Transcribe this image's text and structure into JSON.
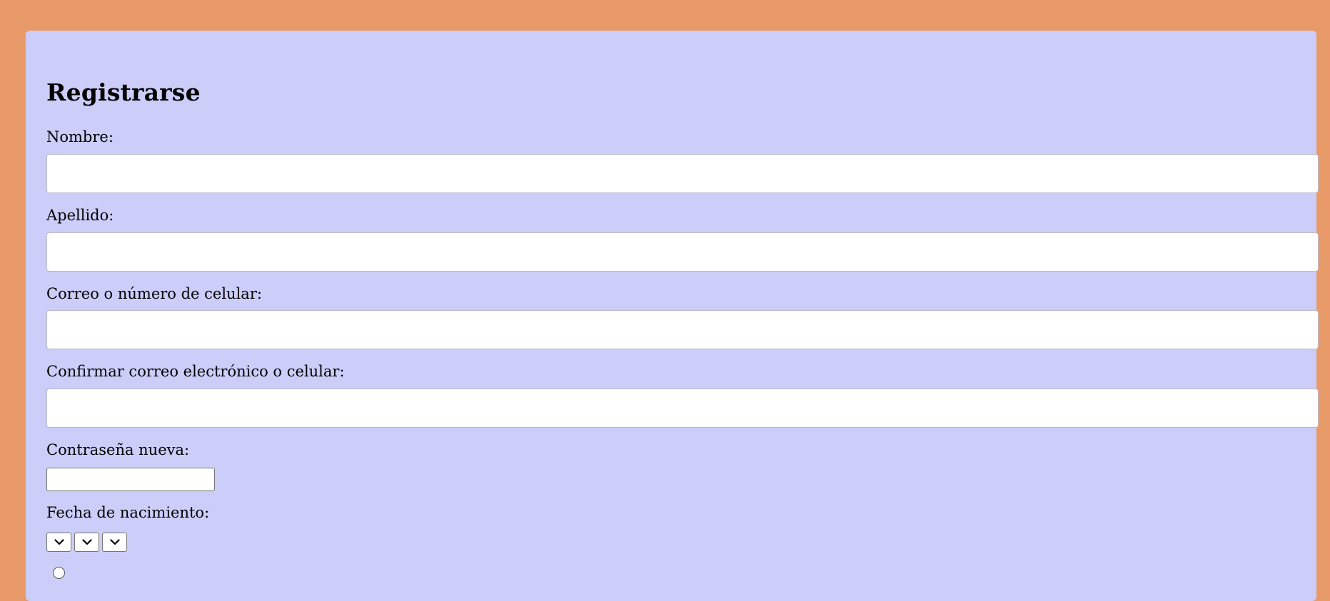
{
  "form": {
    "title": "Registrarse",
    "fields": [
      {
        "label": "Nombre:",
        "value": "",
        "placeholder": ""
      },
      {
        "label": "Apellido:",
        "value": "",
        "placeholder": ""
      },
      {
        "label": "Correo o número de celular:",
        "value": "",
        "placeholder": ""
      },
      {
        "label": "Confirmar correo electrónico o celular:",
        "value": "",
        "placeholder": ""
      }
    ],
    "password": {
      "label": "Contraseña nueva:",
      "value": ""
    },
    "birthdate": {
      "label": "Fecha de nacimiento:",
      "day": "",
      "month": "",
      "year": ""
    }
  },
  "colors": {
    "page_background": "#e99a69",
    "card_background": "#cccdf8",
    "input_background": "#ffffff"
  },
  "icons": {
    "select_arrow": "chevron-down-icon"
  }
}
